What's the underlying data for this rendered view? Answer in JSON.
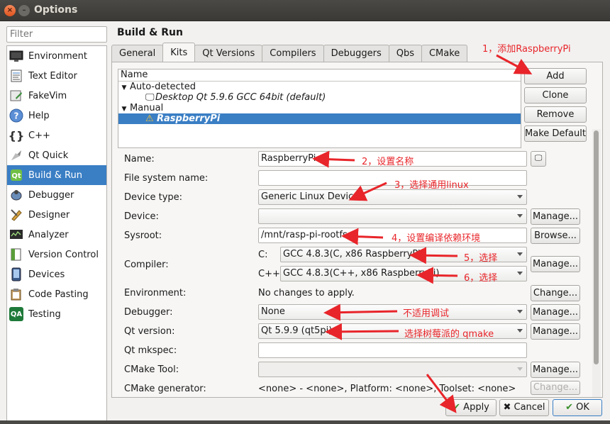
{
  "window": {
    "title": "Options"
  },
  "filter": {
    "placeholder": "Filter"
  },
  "nav": {
    "items": [
      {
        "label": "Environment",
        "icon": "monitor-icon"
      },
      {
        "label": "Text Editor",
        "icon": "text-editor-icon"
      },
      {
        "label": "FakeVim",
        "icon": "fakevim-icon"
      },
      {
        "label": "Help",
        "icon": "help-icon"
      },
      {
        "label": "C++",
        "icon": "cpp-braces-icon"
      },
      {
        "label": "Qt Quick",
        "icon": "qt-quick-icon"
      },
      {
        "label": "Build & Run",
        "icon": "build-run-icon"
      },
      {
        "label": "Debugger",
        "icon": "debugger-icon"
      },
      {
        "label": "Designer",
        "icon": "designer-icon"
      },
      {
        "label": "Analyzer",
        "icon": "analyzer-icon"
      },
      {
        "label": "Version Control",
        "icon": "version-control-icon"
      },
      {
        "label": "Devices",
        "icon": "devices-icon"
      },
      {
        "label": "Code Pasting",
        "icon": "code-pasting-icon"
      },
      {
        "label": "Testing",
        "icon": "testing-qa-icon",
        "badge": "QA"
      }
    ],
    "selected": "Build & Run"
  },
  "section_title": "Build & Run",
  "tabs": [
    "General",
    "Kits",
    "Qt Versions",
    "Compilers",
    "Debuggers",
    "Qbs",
    "CMake"
  ],
  "active_tab": "Kits",
  "kit_tree": {
    "header": "Name",
    "auto_group": "Auto-detected",
    "auto_kit": "Desktop Qt 5.9.6 GCC 64bit (default)",
    "manual_group": "Manual",
    "manual_kit": "RaspberryPi"
  },
  "kit_buttons": {
    "add": "Add",
    "clone": "Clone",
    "remove": "Remove",
    "make_default": "Make Default"
  },
  "form": {
    "name_label": "Name:",
    "name_value": "RaspberryPi",
    "fs_name_label": "File system name:",
    "device_type_label": "Device type:",
    "device_type_value": "Generic Linux Device",
    "device_label": "Device:",
    "sysroot_label": "Sysroot:",
    "sysroot_value": "/mnt/rasp-pi-rootfs",
    "compiler_label": "Compiler:",
    "c_label": "C:",
    "c_value": "GCC 4.8.3(C, x86 RaspberryPi)",
    "cpp_label": "C++:",
    "cpp_value": "GCC 4.8.3(C++, x86 RaspberryPi)",
    "environment_label": "Environment:",
    "environment_value": "No changes to apply.",
    "debugger_label": "Debugger:",
    "debugger_value": "None",
    "qt_version_label": "Qt version:",
    "qt_version_value": "Qt 5.9.9 (qt5pi)",
    "mkspec_label": "Qt mkspec:",
    "cmake_tool_label": "CMake Tool:",
    "cmake_gen_label": "CMake generator:",
    "cmake_gen_value": "<none> - <none>, Platform: <none>, Toolset: <none>"
  },
  "side_buttons": {
    "manage": "Manage...",
    "browse": "Browse...",
    "change": "Change..."
  },
  "footer": {
    "apply": "Apply",
    "cancel": "Cancel",
    "ok": "OK"
  },
  "annotations": {
    "a1": "1，添加RaspberryPi",
    "a2": "2，设置名称",
    "a3": "3，选择通用linux",
    "a4": "4，设置编译依赖环境",
    "a5": "5，选择",
    "a6": "6，选择",
    "a7": "不适用调试",
    "a8": "选择树莓派的 qmake"
  },
  "colors": {
    "selection": "#3a7ec4",
    "annotation": "#e8252a",
    "title_bar": "#3c3b37"
  }
}
